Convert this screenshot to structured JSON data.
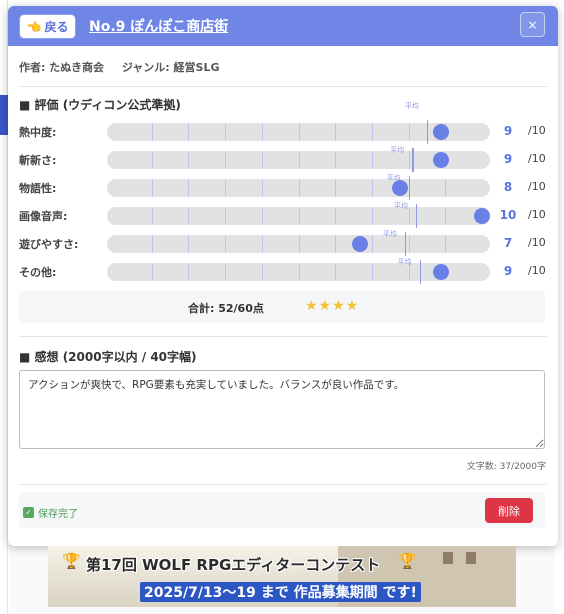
{
  "header": {
    "back_label": "戻る",
    "title": "No.9 ぽんぽこ商店街",
    "close_label": "×"
  },
  "meta": {
    "author": "作者: たぬき商会",
    "genre": "ジャンル: 経営SLG"
  },
  "rating_section": {
    "title": "■ 評価 (ウディコン公式準拠)",
    "avg_label": "平均",
    "max_label": "/10",
    "rows": [
      {
        "label": "熱中度:",
        "score": 9,
        "avg": 8.5
      },
      {
        "label": "斬新さ:",
        "score": 9,
        "avg": 8.1
      },
      {
        "label": "物語性:",
        "score": 8,
        "avg": 8.0
      },
      {
        "label": "画像音声:",
        "score": 10,
        "avg": 8.2
      },
      {
        "label": "遊びやすさ:",
        "score": 7,
        "avg": 7.9
      },
      {
        "label": "その他:",
        "score": 9,
        "avg": 8.3
      }
    ]
  },
  "total": {
    "text": "合計: 52/60点",
    "stars": "★★★★",
    "star_count": 4
  },
  "impression": {
    "title": "■ 感想 (2000字以内 / 40字幅)",
    "value": "アクションが爽快で、RPG要素も充実していました。バランスが良い作品です。",
    "char_count": "文字数: 37/2000字"
  },
  "footer": {
    "save_status": "保存完了",
    "delete_label": "削除"
  },
  "banner": {
    "line1": "第17回 WOLF RPGエディターコンテスト",
    "line2": "2025/7/13〜19 まで 作品募集期間 です!"
  },
  "colors": {
    "header_bg": "#6f86e6",
    "accent": "#6880e6",
    "delete": "#dc3545",
    "save_ok": "#4c9a56"
  }
}
